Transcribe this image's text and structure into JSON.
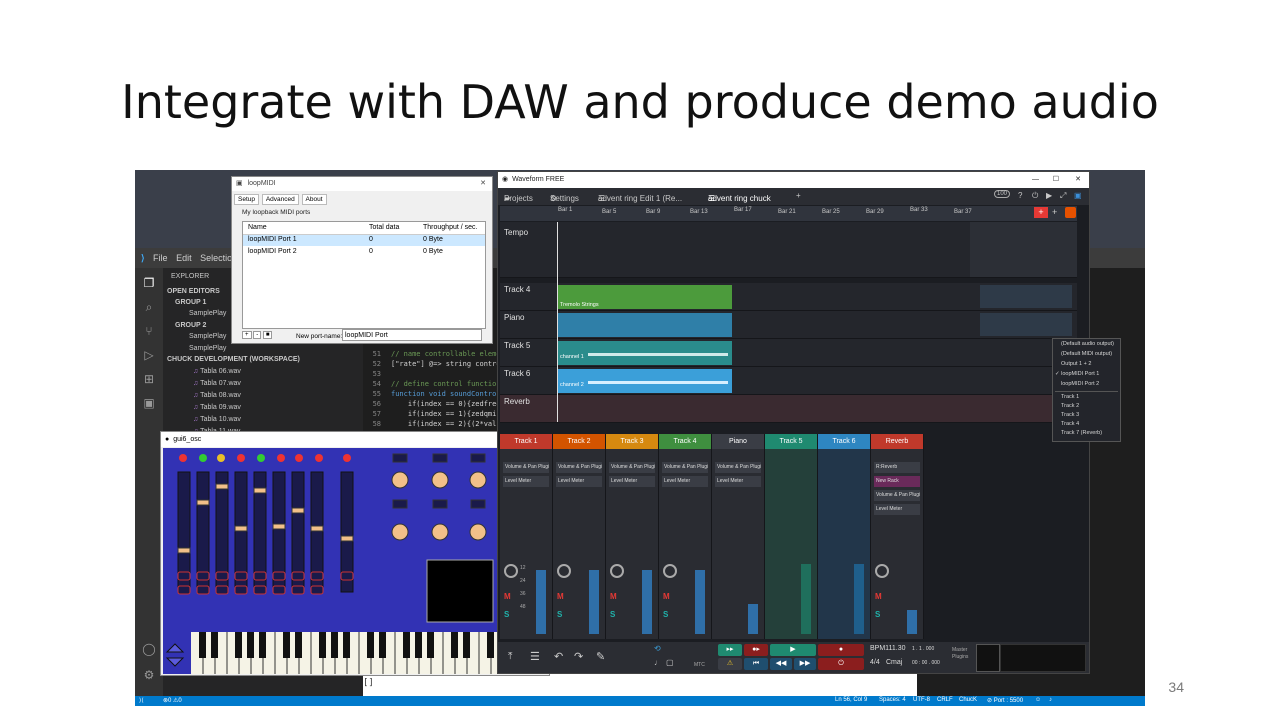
{
  "slide": {
    "title": "Integrate with DAW and produce demo audio",
    "page_number": "34"
  },
  "vscode": {
    "menu": [
      "File",
      "Edit",
      "Selection"
    ],
    "sidebar": {
      "header": "EXPLORER",
      "open_editors": "OPEN EDITORS",
      "group1": "GROUP 1",
      "group1_file": "SamplePlay",
      "group2": "GROUP 2",
      "group2_files": [
        "SamplePlay",
        "SamplePlay"
      ],
      "workspace": "CHUCK DEVELOPMENT (WORKSPACE)",
      "files": [
        "Tabla 06.wav",
        "Tabla 07.wav",
        "Tabla 08.wav",
        "Tabla 09.wav",
        "Tabla 10.wav",
        "Tabla 11.wav"
      ]
    },
    "editor": {
      "lines": [
        {
          "n": "51",
          "text": "// name controllable eleme"
        },
        {
          "n": "52",
          "text": "[\"rate\"] @=> string contro"
        },
        {
          "n": "53",
          "text": ""
        },
        {
          "n": "54",
          "text": "// define control function"
        },
        {
          "n": "55",
          "text": "function void soundControl"
        },
        {
          "n": "56",
          "text": "    if(index == 0){zedfreq"
        },
        {
          "n": "57",
          "text": "    if(index == 1){zedqmin"
        },
        {
          "n": "58",
          "text": "    if(index == 2){(2*valu"
        }
      ]
    },
    "status": {
      "errors": "0",
      "warnings": "0",
      "cursor": "Ln 56, Col 9",
      "spaces": "Spaces: 4",
      "encoding": "UTF-8",
      "eol": "CRLF",
      "language": "ChucK",
      "port": "Port : 5500"
    },
    "cursor_mark": "[]"
  },
  "loopmidi": {
    "title": "loopMIDI",
    "tabs": [
      "Setup",
      "Advanced",
      "About"
    ],
    "section_label": "My loopback MIDI ports",
    "columns": [
      "Name",
      "Total data",
      "Throughput / sec."
    ],
    "rows": [
      {
        "name": "loopMIDI Port 1",
        "total": "0",
        "throughput": "0 Byte"
      },
      {
        "name": "loopMIDI Port 2",
        "total": "0",
        "throughput": "0 Byte"
      }
    ],
    "buttons": [
      "+",
      "-",
      "■"
    ],
    "new_port_label": "New port-name:",
    "new_port_value": "loopMIDI Port"
  },
  "gui6": {
    "title": "gui6_osc"
  },
  "waveform": {
    "title": "Waveform FREE",
    "tabs": [
      "Projects",
      "Settings",
      "advent ring Edit 1 (Re...",
      "advent ring chuck",
      "+"
    ],
    "cpu": "100",
    "ruler": [
      "Bar 1",
      "Bar 5",
      "Bar 9",
      "Bar 13",
      "Bar 17",
      "Bar 21",
      "Bar 25",
      "Bar 29",
      "Bar 33",
      "Bar 37"
    ],
    "tracks": [
      {
        "name": "Tempo"
      },
      {
        "name": "Track 4",
        "clip": "Tremolo Strings"
      },
      {
        "name": "Piano"
      },
      {
        "name": "Track 5",
        "clip": "channel 1"
      },
      {
        "name": "Track 6",
        "clip": "channel 2"
      },
      {
        "name": "Reverb"
      }
    ],
    "context_menu": {
      "outputs": [
        "(Default audio output)",
        "(Default MIDI output)",
        "Output 1 + 2",
        "loopMIDI Port 1",
        "loopMIDI Port 2"
      ],
      "checked": "loopMIDI Port 1",
      "tracks": [
        "Track 1",
        "Track 2",
        "Track 3",
        "Track 4",
        "Track 5",
        "Track 6",
        "Track 7 (Reverb)"
      ]
    },
    "mixer": [
      {
        "name": "Track 1",
        "color": "#c0392b",
        "plugins": [
          "Volume & Pan Plugin",
          "Level Meter"
        ]
      },
      {
        "name": "Track 2",
        "color": "#d35400",
        "plugins": [
          "Volume & Pan Plugin",
          "Level Meter"
        ]
      },
      {
        "name": "Track 3",
        "color": "#d68910",
        "plugins": [
          "Volume & Pan Plugin",
          "Level Meter"
        ]
      },
      {
        "name": "Track 4",
        "color": "#3f8f3f",
        "plugins": [
          "Volume & Pan Plugin",
          "Level Meter"
        ]
      },
      {
        "name": "Piano",
        "color": "#3a3d45",
        "plugins": [
          "Volume & Pan Plugin",
          "Level Meter"
        ]
      },
      {
        "name": "Track 5",
        "color": "#1f8a70",
        "plugins": []
      },
      {
        "name": "Track 6",
        "color": "#2e86c1",
        "plugins": []
      },
      {
        "name": "Reverb",
        "color": "#c0392b",
        "plugins": [
          "R:Reverb",
          "New Rack",
          "Volume & Pan Plugin",
          "Level Meter"
        ]
      }
    ],
    "meter_scale": [
      "12",
      "24",
      "36",
      "48"
    ],
    "transport": {
      "bpm": "BPM111.30",
      "position": "1 . 1 . 000",
      "time_sig": "4/4",
      "key": "Cmaj",
      "time": "00 : 00 . 000",
      "mtc": "MTC",
      "master": "Master Plugins"
    }
  },
  "colors": {
    "accent_blue": "#007acc",
    "gui_blue": "#3232b4",
    "record_red": "#d32f2f",
    "clip_green": "#4c9b3c",
    "clip_teal": "#2a8c8c"
  }
}
